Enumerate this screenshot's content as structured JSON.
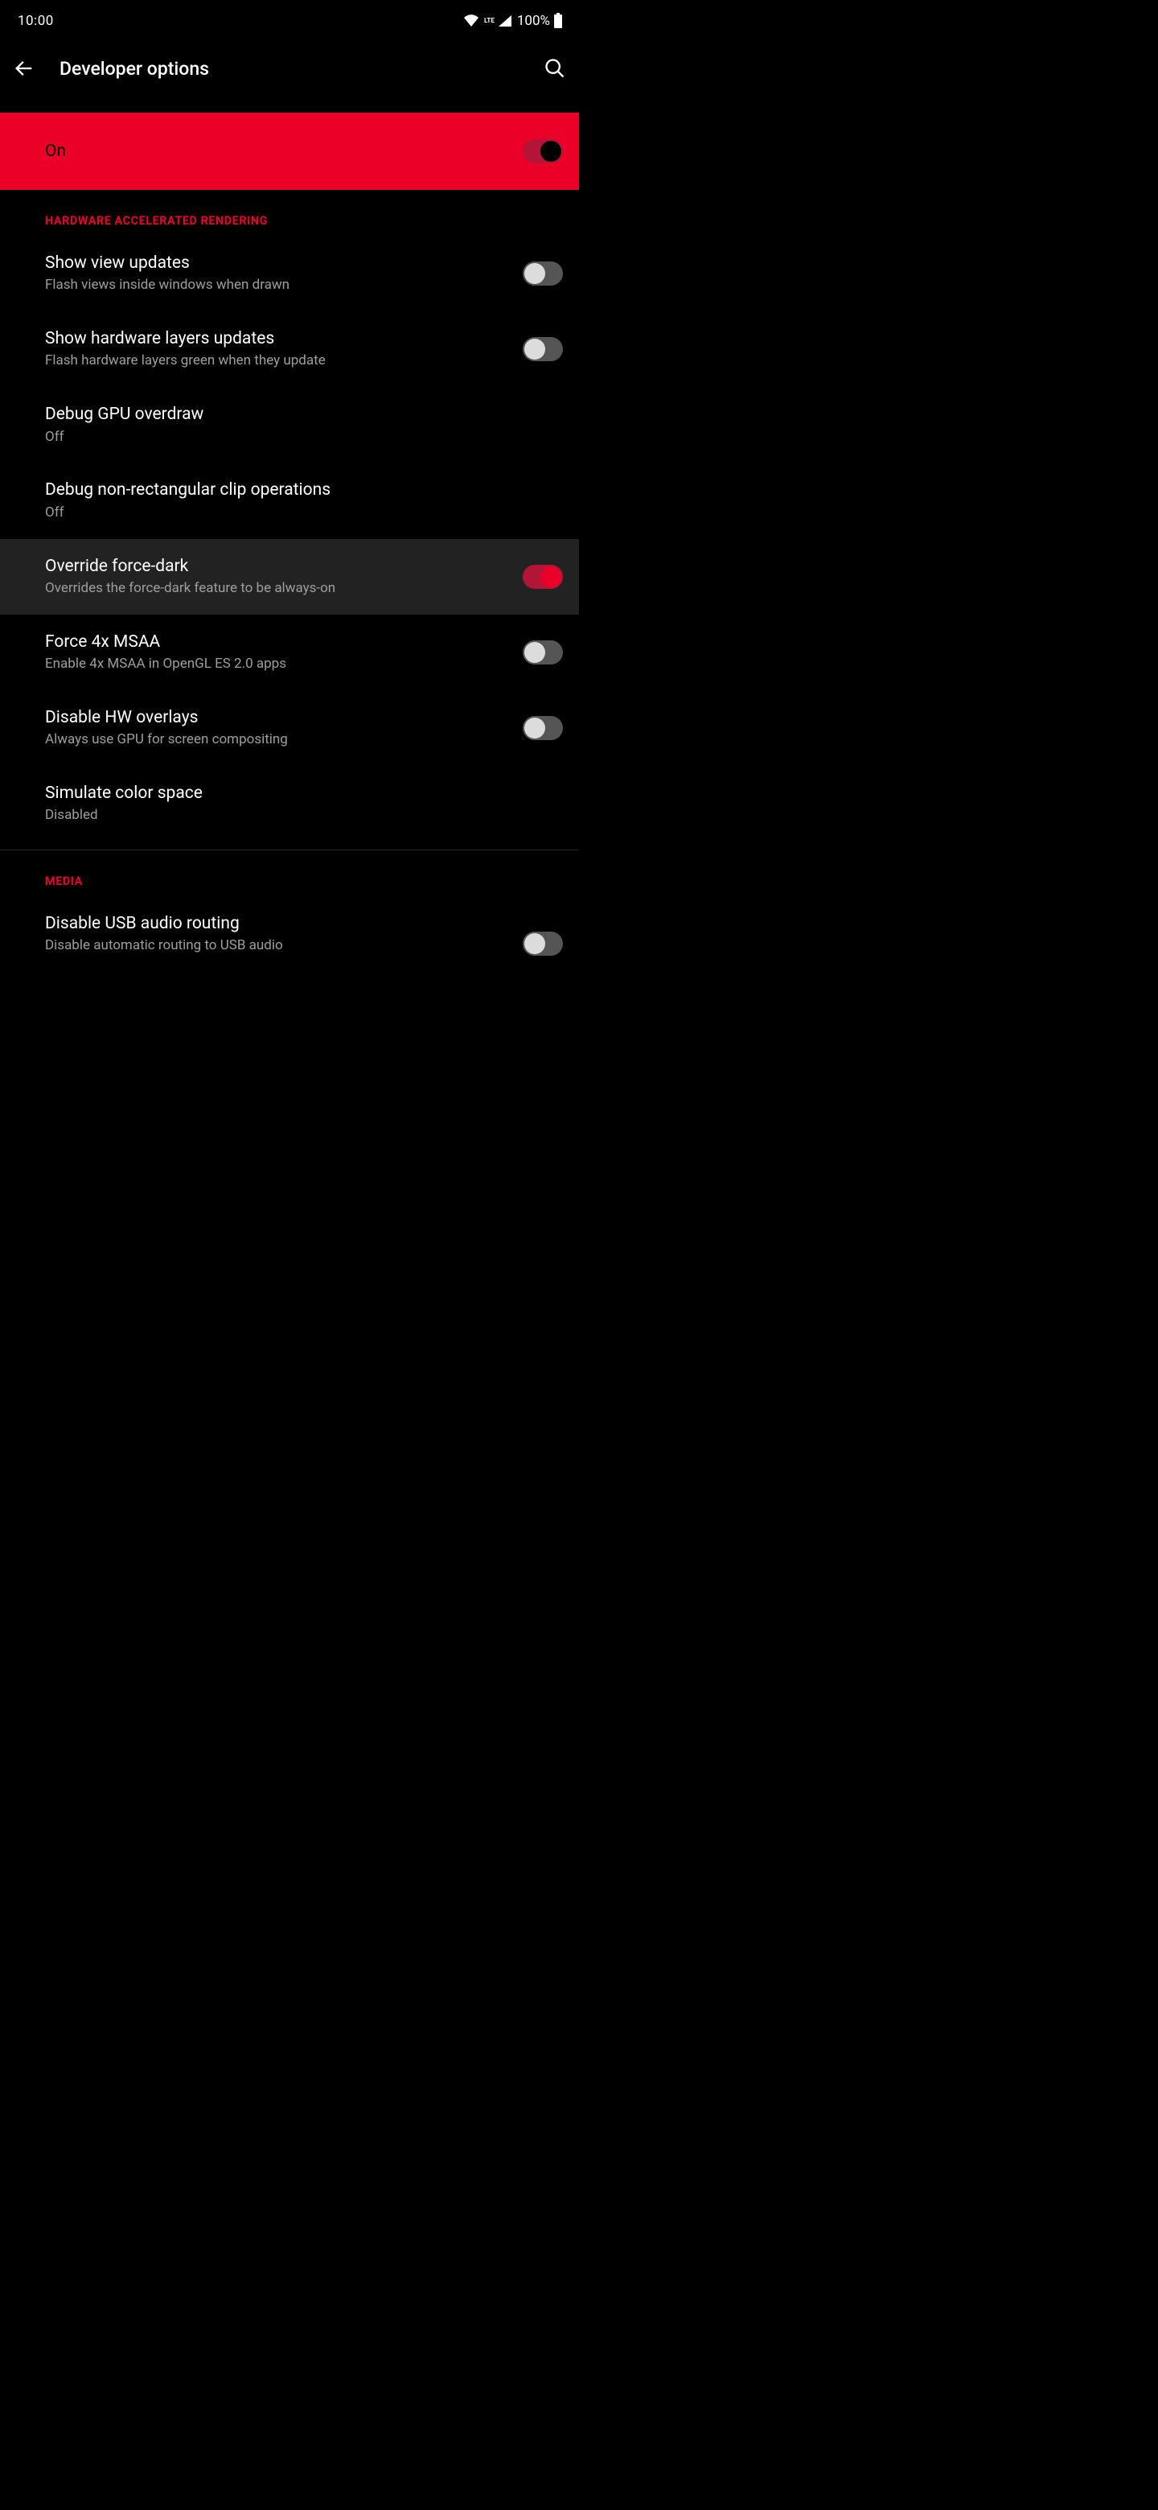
{
  "status": {
    "time": "10:00",
    "network_type": "LTE",
    "battery": "100%"
  },
  "header": {
    "title": "Developer options"
  },
  "master": {
    "label": "On"
  },
  "sections": [
    {
      "title": "HARDWARE ACCELERATED RENDERING",
      "items": [
        {
          "title": "Show view updates",
          "sub": "Flash views inside windows when drawn",
          "toggle": "off"
        },
        {
          "title": "Show hardware layers updates",
          "sub": "Flash hardware layers green when they update",
          "toggle": "off"
        },
        {
          "title": "Debug GPU overdraw",
          "sub": "Off"
        },
        {
          "title": "Debug non-rectangular clip operations",
          "sub": "Off"
        },
        {
          "title": "Override force-dark",
          "sub": "Overrides the force-dark feature to be always-on",
          "toggle": "on",
          "highlight": true
        },
        {
          "title": "Force 4x MSAA",
          "sub": "Enable 4x MSAA in OpenGL ES 2.0 apps",
          "toggle": "off"
        },
        {
          "title": "Disable HW overlays",
          "sub": "Always use GPU for screen compositing",
          "toggle": "off"
        },
        {
          "title": "Simulate color space",
          "sub": "Disabled"
        }
      ]
    },
    {
      "title": "MEDIA",
      "items": [
        {
          "title": "Disable USB audio routing",
          "sub": "Disable automatic routing to USB audio",
          "toggle": "off"
        }
      ]
    }
  ]
}
